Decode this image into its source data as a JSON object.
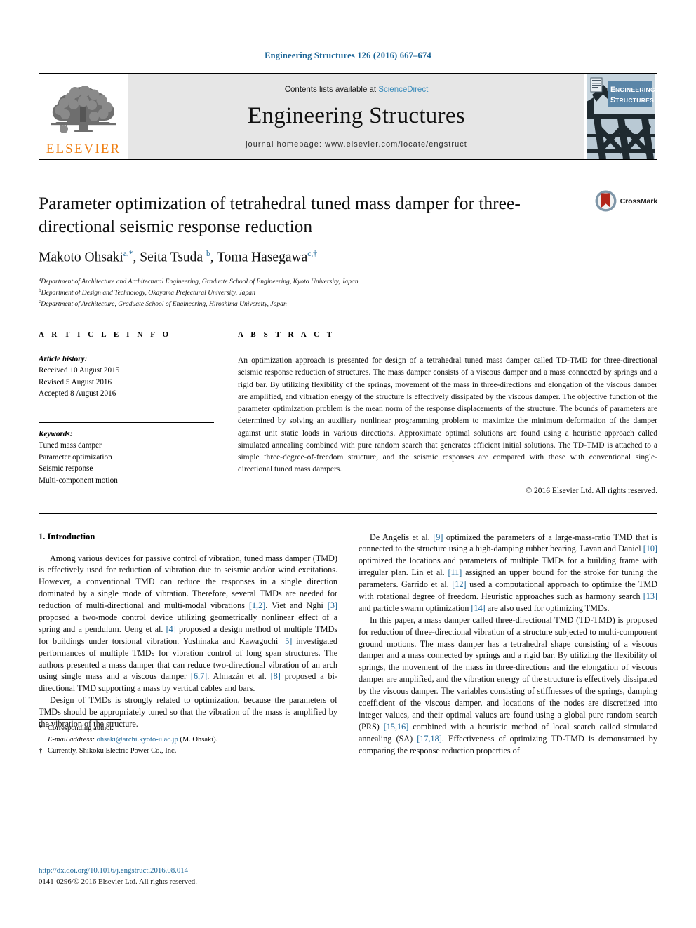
{
  "running_head": "Engineering Structures 126 (2016) 667–674",
  "masthead": {
    "contents_prefix": "Contents lists available at ",
    "sciencedirect": "ScienceDirect",
    "journal_name": "Engineering Structures",
    "homepage": "journal homepage: www.elsevier.com/locate/engstruct",
    "publisher_name": "ELSEVIER",
    "cover_title_line1": "ENGINEERING",
    "cover_title_line2": "STRUCTURES",
    "colors": {
      "link": "#3c8dbc",
      "elsevier_orange": "#F07F13",
      "masthead_bg": "#e6e6e6",
      "running_head": "#1a6496"
    }
  },
  "crossmark": {
    "label": "CrossMark"
  },
  "article": {
    "title": "Parameter optimization of tetrahedral tuned mass damper for three-directional seismic response reduction",
    "authors_html": "Makoto Ohsaki<sup>a,*</sup>, Seita Tsuda <sup>b</sup>, Toma Hasegawa<sup>c,†</sup>",
    "affiliations": [
      {
        "marker": "a",
        "text": "Department of Architecture and Architectural Engineering, Graduate School of Engineering, Kyoto University, Japan"
      },
      {
        "marker": "b",
        "text": "Department of Design and Technology, Okayama Prefectural University, Japan"
      },
      {
        "marker": "c",
        "text": "Department of Architecture, Graduate School of Engineering, Hiroshima University, Japan"
      }
    ]
  },
  "article_info": {
    "heading": "A R T I C L E   I N F O",
    "history_label": "Article history:",
    "history": [
      "Received 10 August 2015",
      "Revised 5 August 2016",
      "Accepted 8 August 2016"
    ],
    "keywords_label": "Keywords:",
    "keywords": [
      "Tuned mass damper",
      "Parameter optimization",
      "Seismic response",
      "Multi-component motion"
    ]
  },
  "abstract": {
    "heading": "A B S T R A C T",
    "text": "An optimization approach is presented for design of a tetrahedral tuned mass damper called TD-TMD for three-directional seismic response reduction of structures. The mass damper consists of a viscous damper and a mass connected by springs and a rigid bar. By utilizing flexibility of the springs, movement of the mass in three-directions and elongation of the viscous damper are amplified, and vibration energy of the structure is effectively dissipated by the viscous damper. The objective function of the parameter optimization problem is the mean norm of the response displacements of the structure. The bounds of parameters are determined by solving an auxiliary nonlinear programming problem to maximize the minimum deformation of the damper against unit static loads in various directions. Approximate optimal solutions are found using a heuristic approach called simulated annealing combined with pure random search that generates efficient initial solutions. The TD-TMD is attached to a simple three-degree-of-freedom structure, and the seismic responses are compared with those with conventional single-directional tuned mass dampers.",
    "copyright": "© 2016 Elsevier Ltd. All rights reserved."
  },
  "body": {
    "section_heading": "1. Introduction",
    "left_paragraphs": [
      "Among various devices for passive control of vibration, tuned mass damper (TMD) is effectively used for reduction of vibration due to seismic and/or wind excitations. However, a conventional TMD can reduce the responses in a single direction dominated by a single mode of vibration. Therefore, several TMDs are needed for reduction of multi-directional and multi-modal vibrations [1,2]. Viet and Nghi [3] proposed a two-mode control device utilizing geometrically nonlinear effect of a spring and a pendulum. Ueng et al. [4] proposed a design method of multiple TMDs for buildings under torsional vibration. Yoshinaka and Kawaguchi [5] investigated performances of multiple TMDs for vibration control of long span structures. The authors presented a mass damper that can reduce two-directional vibration of an arch using single mass and a viscous damper [6,7]. Almazán et al. [8] proposed a bi-directional TMD supporting a mass by vertical cables and bars.",
      "Design of TMDs is strongly related to optimization, because the parameters of TMDs should be appropriately tuned so that the vibration of the mass is amplified by the vibration of the structure."
    ],
    "right_paragraphs": [
      "De Angelis et al. [9] optimized the parameters of a large-mass-ratio TMD that is connected to the structure using a high-damping rubber bearing. Lavan and Daniel [10] optimized the locations and parameters of multiple TMDs for a building frame with irregular plan. Lin et al. [11] assigned an upper bound for the stroke for tuning the parameters. Garrido et al. [12] used a computational approach to optimize the TMD with rotational degree of freedom. Heuristic approaches such as harmony search [13] and particle swarm optimization [14] are also used for optimizing TMDs.",
      "In this paper, a mass damper called three-directional TMD (TD-TMD) is proposed for reduction of three-directional vibration of a structure subjected to multi-component ground motions. The mass damper has a tetrahedral shape consisting of a viscous damper and a mass connected by springs and a rigid bar. By utilizing the flexibility of springs, the movement of the mass in three-directions and the elongation of viscous damper are amplified, and the vibration energy of the structure is effectively dissipated by the viscous damper. The variables consisting of stiffnesses of the springs, damping coefficient of the viscous damper, and locations of the nodes are discretized into integer values, and their optimal values are found using a global pure random search (PRS) [15,16] combined with a heuristic method of local search called simulated annealing (SA) [17,18]. Effectiveness of optimizing TD-TMD is demonstrated by comparing the response reduction properties of"
    ]
  },
  "footnotes": {
    "corresponding_marker": "*",
    "corresponding_text": "Corresponding author.",
    "email_label": "E-mail address:",
    "email": "ohsaki@archi.kyoto-u.ac.jp",
    "email_suffix": "(M. Ohsaki).",
    "current_marker": "†",
    "current_text": "Currently, Shikoku Electric Power Co., Inc."
  },
  "page_footer": {
    "doi": "http://dx.doi.org/10.1016/j.engstruct.2016.08.014",
    "issn_line": "0141-0296/© 2016 Elsevier Ltd. All rights reserved."
  }
}
